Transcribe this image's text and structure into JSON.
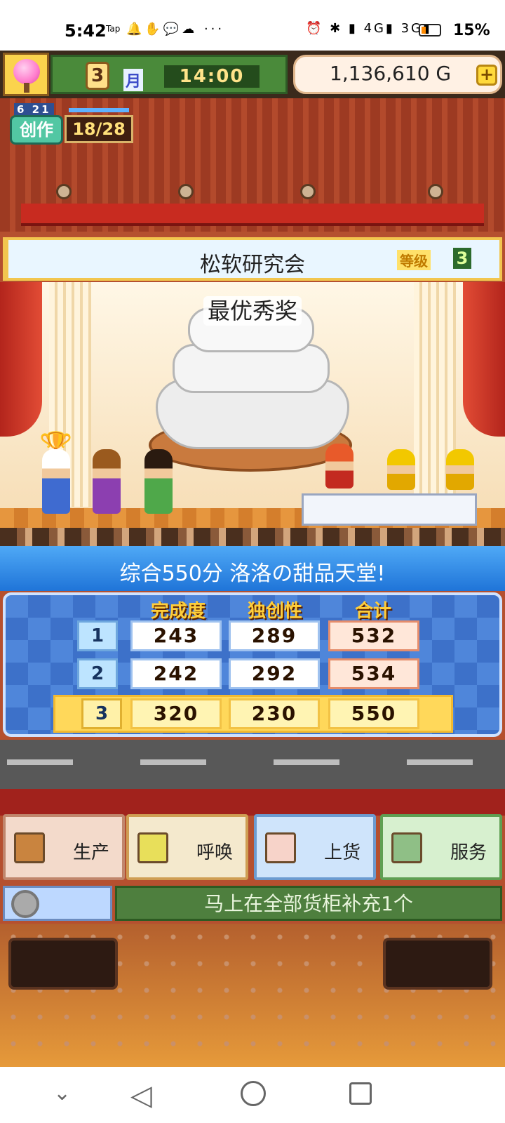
{
  "statusbar": {
    "time": "5:42",
    "app_tag": "Tap",
    "left_icons": "🔔✋💬☁ ···",
    "right_icons": "⏰ ✱ ▮ 4G▮ 3G▮",
    "battery": "15%",
    "battery_color": "#ff8a00"
  },
  "topbar": {
    "month_number": "3",
    "month_label": "月",
    "time": "14:00",
    "money": "1,136,610 G",
    "plus_label": "+"
  },
  "create": {
    "date": "6 21",
    "label": "创作",
    "count": "18/28"
  },
  "contest": {
    "name": "松软研究会",
    "level_label": "等级",
    "level_value": "3",
    "award": "最优秀奖"
  },
  "score": {
    "title": "综合550分 洛洛の甜品天堂!",
    "headers": [
      "完成度",
      "独创性",
      "合计"
    ],
    "rows": [
      {
        "label": "1",
        "completion": "243",
        "originality": "289",
        "total": "532"
      },
      {
        "label": "2",
        "completion": "242",
        "originality": "292",
        "total": "534"
      },
      {
        "label": "3",
        "completion": "320",
        "originality": "230",
        "total": "550"
      }
    ]
  },
  "actions": {
    "produce": "生产",
    "call": "呼唤",
    "stock": "上货",
    "service": "服务"
  },
  "restock_text": "马上在全部货柜补充1个",
  "colors": {
    "score_header": "#1f74d8",
    "highlight_row": "#ffd85a",
    "restock_bg": "#4e7f3e"
  }
}
